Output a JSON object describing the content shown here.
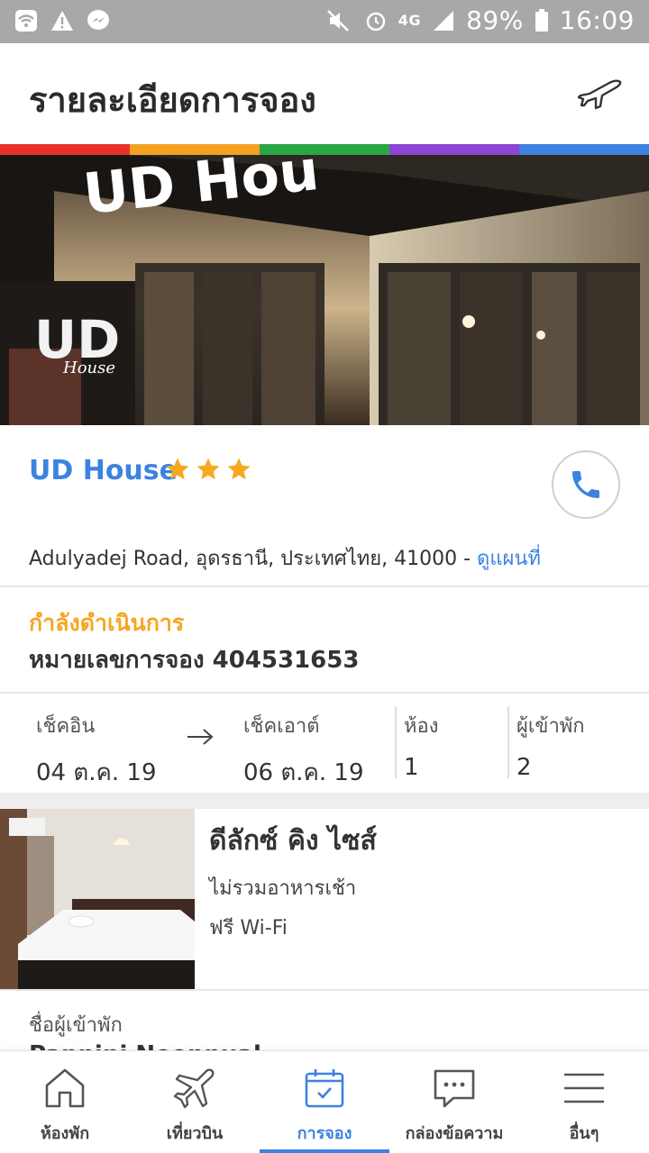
{
  "status_bar": {
    "battery": "89%",
    "time": "16:09",
    "network": "4G"
  },
  "header": {
    "title": "รายละเอียดการจอง"
  },
  "accent_colors": [
    "#e8312b",
    "#f4a020",
    "#29a745",
    "#8e44d4",
    "#3d82e0"
  ],
  "hotel": {
    "name": "UD House",
    "stars": 3,
    "address": "Adulyadej Road, อุดรธานี, ประเทศไทย, 41000 - ",
    "map_link": "ดูแผนที่"
  },
  "booking": {
    "status": "กำลังดำเนินการ",
    "number_label": "หมายเลขการจอง 404531653"
  },
  "dates": {
    "checkin_label": "เช็คอิน",
    "checkin_value": "04 ต.ค. 19",
    "checkout_label": "เช็คเอาต์",
    "checkout_value": "06 ต.ค. 19",
    "rooms_label": "ห้อง",
    "rooms_value": "1",
    "guests_label": "ผู้เข้าพัก",
    "guests_value": "2"
  },
  "room": {
    "title": "ดีลักซ์ คิง ไซส์",
    "features": [
      "ไม่รวมอาหารเช้า",
      "ฟรี Wi-Fi"
    ]
  },
  "guest": {
    "label": "ชื่อผู้เข้าพัก",
    "name": "Pannipi Noonnual"
  },
  "nav": {
    "items": [
      {
        "label": "ห้องพัก",
        "icon": "home-icon"
      },
      {
        "label": "เที่ยวบิน",
        "icon": "plane-icon"
      },
      {
        "label": "การจอง",
        "icon": "calendar-check-icon"
      },
      {
        "label": "กล่องข้อความ",
        "icon": "chat-icon"
      },
      {
        "label": "อื่นๆ",
        "icon": "menu-icon"
      }
    ],
    "active": "การจอง"
  }
}
